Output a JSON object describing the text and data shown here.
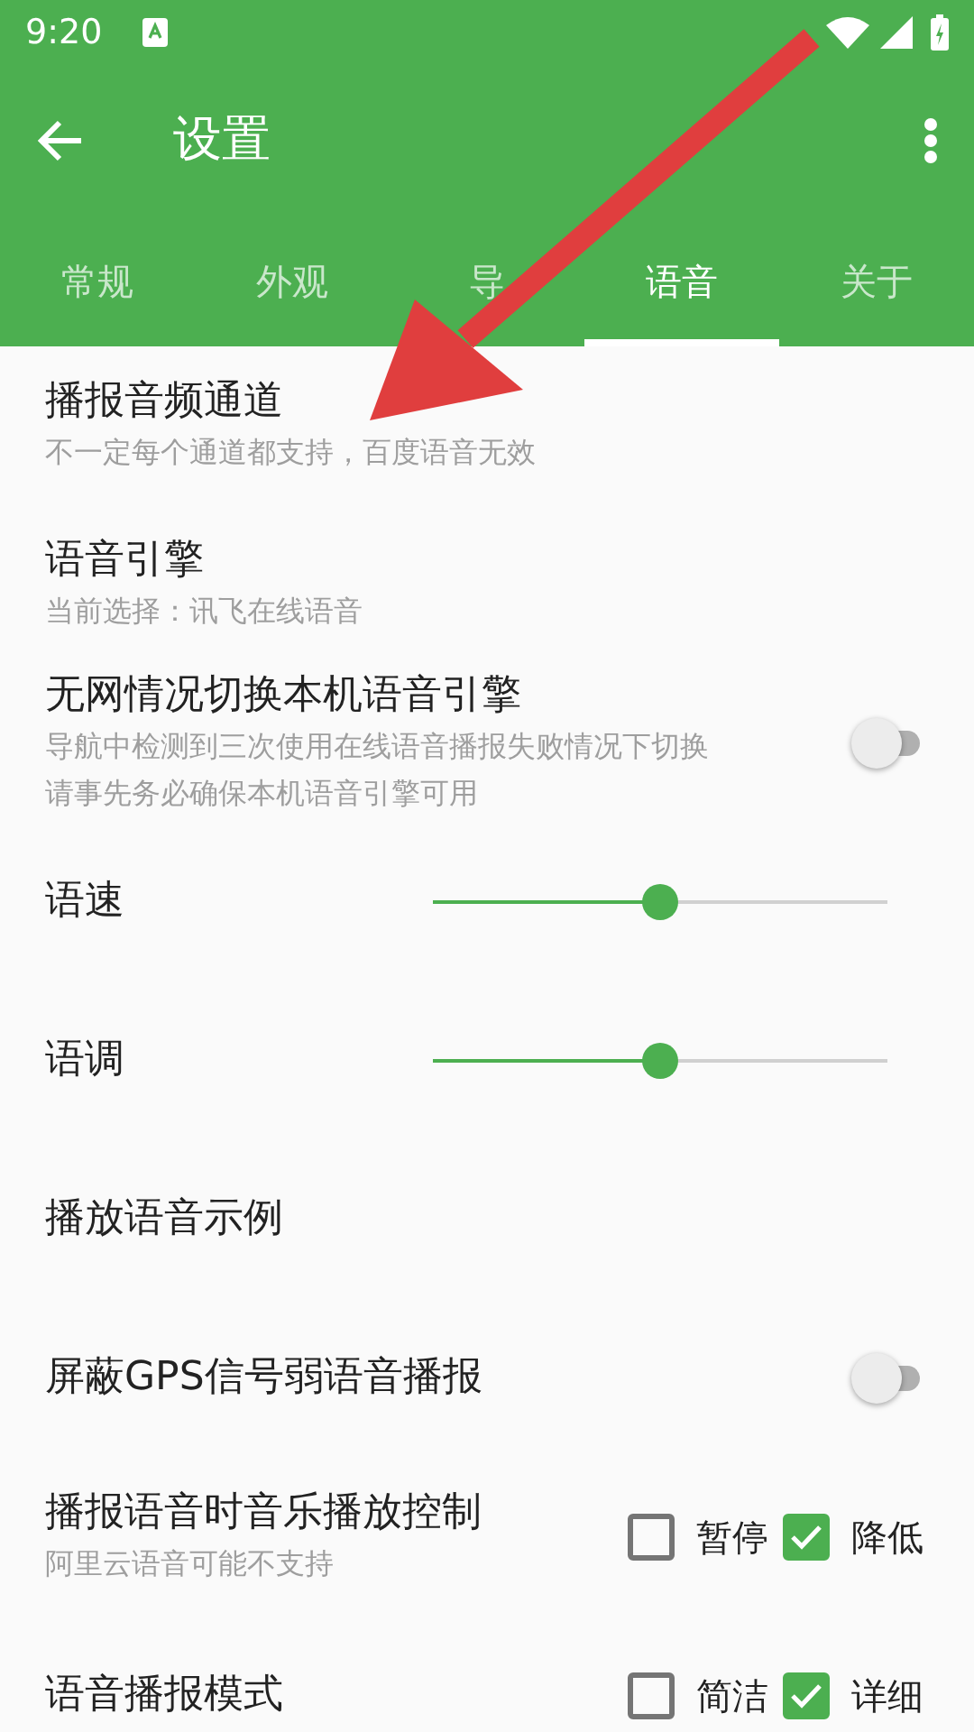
{
  "status_bar": {
    "time": "9:20"
  },
  "toolbar": {
    "title": "设置"
  },
  "tabs": [
    {
      "label": "常规",
      "selected": false
    },
    {
      "label": "外观",
      "selected": false
    },
    {
      "label": "导",
      "selected": false
    },
    {
      "label": "语音",
      "selected": true
    },
    {
      "label": "关于",
      "selected": false
    }
  ],
  "settings": [
    {
      "kind": "text",
      "title": "播报音频通道",
      "summary": [
        "不一定每个通道都支持，百度语音无效"
      ]
    },
    {
      "kind": "text",
      "title": "语音引擎",
      "summary": [
        "当前选择：讯飞在线语音"
      ]
    },
    {
      "kind": "switch",
      "title": "无网情况切换本机语音引擎",
      "summary": [
        "导航中检测到三次使用在线语音播报失败情况下切换",
        "请事先务必确保本机语音引擎可用"
      ],
      "on": false
    },
    {
      "kind": "slider",
      "title": "语速",
      "level": 0.5
    },
    {
      "kind": "slider",
      "title": "语调",
      "level": 0.5
    },
    {
      "kind": "text",
      "title": "播放语音示例"
    },
    {
      "kind": "switch",
      "title": "屏蔽GPS信号弱语音播报",
      "on": false
    },
    {
      "kind": "checks",
      "title": "播报语音时音乐播放控制",
      "summary": [
        "阿里云语音可能不支持"
      ],
      "options": [
        {
          "label": "暂停",
          "checked": false
        },
        {
          "label": "降低",
          "checked": true
        }
      ]
    },
    {
      "kind": "checks",
      "title": "语音播报模式",
      "options": [
        {
          "label": "简洁",
          "checked": false
        },
        {
          "label": "详细",
          "checked": true
        }
      ]
    }
  ]
}
